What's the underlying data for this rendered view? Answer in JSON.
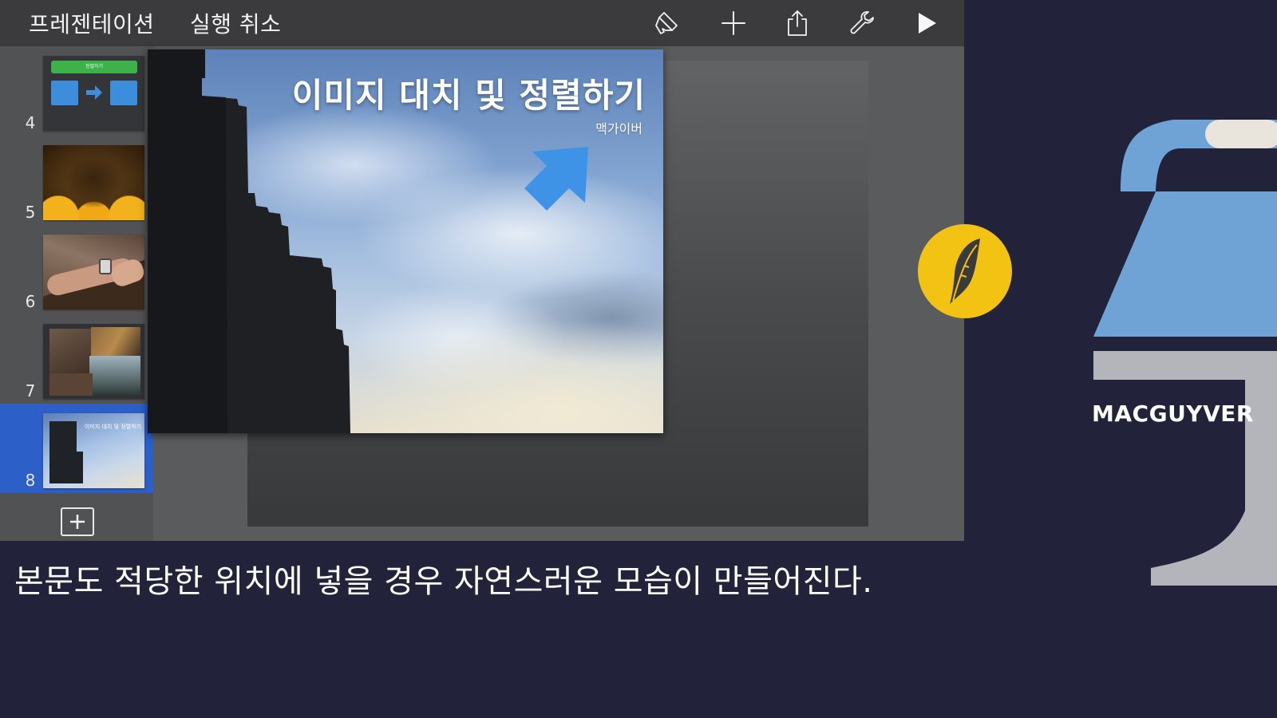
{
  "toolbar": {
    "presentations_label": "프레젠테이션",
    "undo_label": "실행 취소",
    "icons": [
      "format-brush-icon",
      "plus-icon",
      "share-icon",
      "wrench-icon",
      "play-icon"
    ]
  },
  "navigator": {
    "slides": [
      {
        "number": "4",
        "thumb_text": "정렬하기"
      },
      {
        "number": "5"
      },
      {
        "number": "6"
      },
      {
        "number": "7"
      },
      {
        "number": "8",
        "selected": true,
        "thumb_text": "이미지 대치 및 정렬하기"
      }
    ],
    "add_slide_icon": "plus-box-icon"
  },
  "slide": {
    "title": "이미지 대치 및 정렬하기",
    "subtitle": "맥가이버"
  },
  "caption": "본문도 적당한 위치에 넣을 경우 자연스러운 모습이 만들어진다.",
  "brand": {
    "name": "MACGUYVER",
    "badge_icon": "feather-icon",
    "colors": {
      "background": "#22223a",
      "badge": "#f2c313",
      "blue": "#6fa3d6",
      "grey": "#b4b5bb",
      "selection": "#2c5fc7"
    }
  }
}
